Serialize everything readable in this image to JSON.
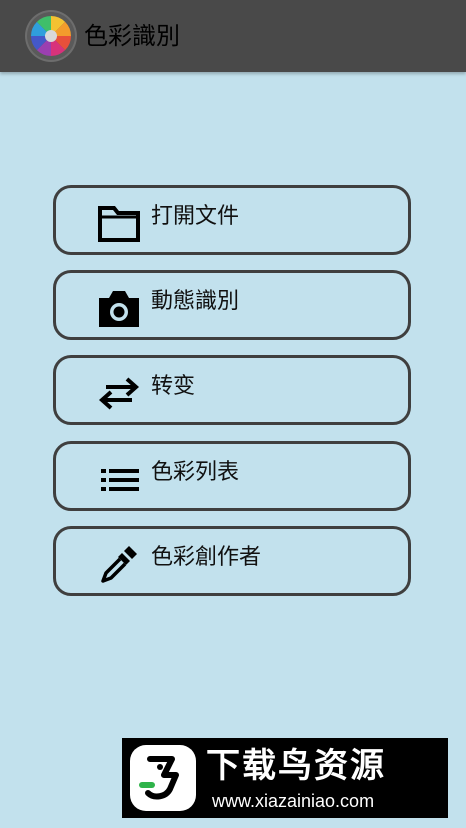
{
  "app": {
    "title": "色彩識別",
    "logo_icon": "color-wheel-icon"
  },
  "menu": [
    {
      "label": "打開文件",
      "icon": "folder-icon"
    },
    {
      "label": "動態識別",
      "icon": "camera-icon"
    },
    {
      "label": "转变",
      "icon": "swap-arrows-icon"
    },
    {
      "label": "色彩列表",
      "icon": "list-icon"
    },
    {
      "label": "色彩創作者",
      "icon": "eyedropper-icon"
    }
  ],
  "watermark": {
    "title": "下载鸟资源",
    "url": "www.xiazainiao.com",
    "logo_icon": "bird-logo-icon"
  },
  "colors": {
    "appbar": "#494949",
    "background": "#c2e1ed",
    "button_border": "#3f3f3f"
  }
}
